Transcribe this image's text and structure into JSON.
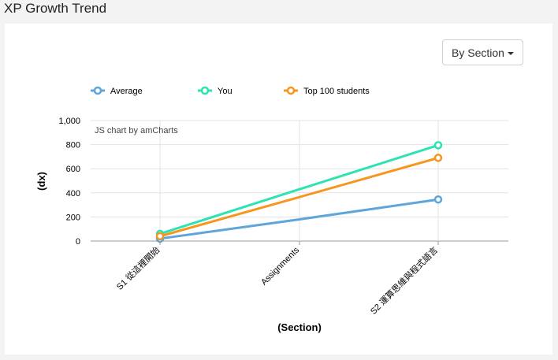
{
  "page": {
    "title": "XP Growth Trend"
  },
  "controls": {
    "dropdown_label": "By Section"
  },
  "chart_data": {
    "type": "line",
    "categories": [
      "S1 從這裡開始",
      "Assignments",
      "S2 運算思維與程式語言"
    ],
    "series": [
      {
        "name": "Average",
        "color": "#5da5da",
        "values": [
          20,
          180,
          345
        ]
      },
      {
        "name": "You",
        "color": "#2de3b3",
        "values": [
          60,
          430,
          795
        ]
      },
      {
        "name": "Top 100 students",
        "color": "#f7961e",
        "values": [
          40,
          365,
          690
        ]
      }
    ],
    "xlabel": "(Section)",
    "ylabel": "(xp)",
    "ylim": [
      0,
      1000
    ],
    "yticks": [
      0,
      200,
      400,
      600,
      800,
      1000
    ],
    "ytick_labels": [
      "0",
      "200",
      "400",
      "600",
      "800",
      "1,000"
    ],
    "grid": true,
    "legend_position": "top-left",
    "credit": "JS chart by amCharts"
  }
}
